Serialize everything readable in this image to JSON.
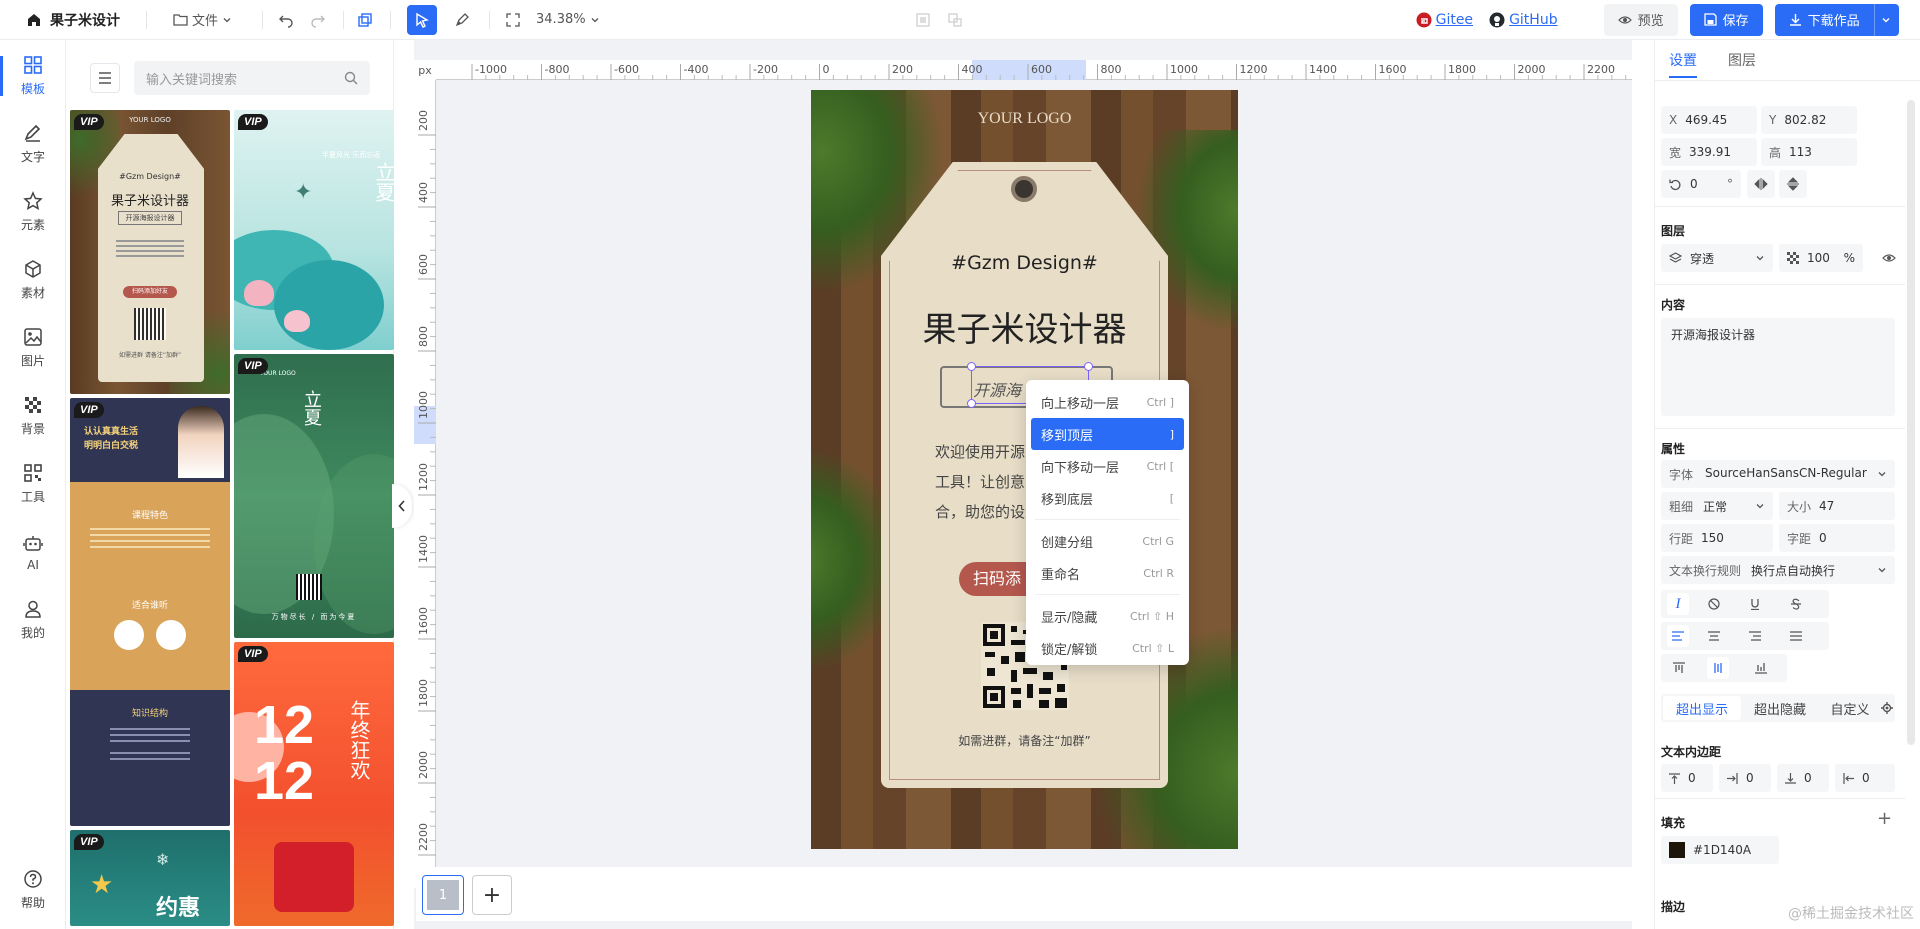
{
  "app": {
    "title": "果子米设计",
    "file_menu": "文件",
    "zoom": "34.38%"
  },
  "links": {
    "gitee": "Gitee",
    "github": "GitHub"
  },
  "actions": {
    "preview": "预览",
    "save": "保存",
    "download": "下载作品"
  },
  "nav": [
    {
      "label": "模板",
      "icon": "grid-icon"
    },
    {
      "label": "文字",
      "icon": "pen-icon"
    },
    {
      "label": "元素",
      "icon": "star-icon"
    },
    {
      "label": "素材",
      "icon": "cube-icon"
    },
    {
      "label": "图片",
      "icon": "image-icon"
    },
    {
      "label": "背景",
      "icon": "checker-icon"
    },
    {
      "label": "工具",
      "icon": "qrcode-icon"
    },
    {
      "label": "AI",
      "icon": "robot-icon"
    },
    {
      "label": "我的",
      "icon": "user-icon"
    },
    {
      "label": "帮助",
      "icon": "help-icon"
    }
  ],
  "search": {
    "placeholder": "输入关键词搜索"
  },
  "templates": {
    "t1": {
      "vip": "VIP",
      "logo": "YOUR LOGO",
      "tag": "#Gzm Design#",
      "title": "果子米设计器",
      "sub": "开源海报设计器",
      "btn": "扫码添加好友",
      "foot": "如需进群 请备注“加群”"
    },
    "t2": {
      "vip": "VIP",
      "title": "立夏",
      "sub": "半夏风光 乐而忘返"
    },
    "t3": {
      "vip": "VIP",
      "title": "认认真真生活",
      "title2": "明明白白交税",
      "sec1": "课程特色",
      "sec2": "适合谁听",
      "sec3": "知识结构"
    },
    "t4": {
      "vip": "VIP",
      "logo": "YOUR LOGO",
      "title": "立夏",
      "foot": "万物尽长 / 而为今夏"
    },
    "t5": {
      "vip": "VIP",
      "num": "12",
      "num2": "12",
      "text": "年终狂欢"
    },
    "t6": {
      "vip": "VIP",
      "text": "约惠"
    }
  },
  "ruler": {
    "unit": "px",
    "h_labels": [
      "-1000",
      "-800",
      "-600",
      "-400",
      "-200",
      "0",
      "200",
      "400",
      "600",
      "800",
      "1000",
      "1200",
      "1400",
      "1600",
      "1800",
      "2000",
      "2200"
    ],
    "v_labels": [
      "200",
      "400",
      "600",
      "800",
      "1000",
      "1200",
      "1400",
      "1600",
      "1800",
      "2000",
      "2200"
    ]
  },
  "poster": {
    "logo": "YOUR LOGO",
    "tag": "#Gzm Design#",
    "title": "果子米设计器",
    "selected_text": "开源海",
    "body1": "欢迎使用开源",
    "body2": "工具！让创意",
    "body3": "合，助您的设",
    "scan_btn": "扫码添",
    "footer": "如需进群，请备注“加群”"
  },
  "context_menu": [
    {
      "label": "向上移动一层",
      "shortcut": "Ctrl ]"
    },
    {
      "label": "移到顶层",
      "shortcut": "]",
      "active": true
    },
    {
      "label": "向下移动一层",
      "shortcut": "Ctrl ["
    },
    {
      "label": "移到底层",
      "shortcut": "["
    },
    {
      "label": "创建分组",
      "shortcut": "Ctrl G"
    },
    {
      "label": "重命名",
      "shortcut": "Ctrl R"
    },
    {
      "label": "显示/隐藏",
      "shortcut": "Ctrl ⇧ H"
    },
    {
      "label": "锁定/解锁",
      "shortcut": "Ctrl ⇧ L"
    }
  ],
  "pages": {
    "current": "1",
    "add": "+"
  },
  "panel": {
    "tabs": [
      "设置",
      "图层"
    ],
    "x_label": "X",
    "x": "469.45",
    "y_label": "Y",
    "y": "802.82",
    "w_label": "宽",
    "w": "339.91",
    "h_label": "高",
    "h": "113",
    "rotation": "0",
    "rotation_unit": "°",
    "layer_section": "图层",
    "blend": "穿透",
    "opacity": "100",
    "opacity_unit": "%",
    "content_section": "内容",
    "content": "开源海报设计器",
    "props_section": "属性",
    "font_label": "字体",
    "font": "SourceHanSansCN-Regular",
    "weight_label": "粗细",
    "weight": "正常",
    "size_label": "大小",
    "size": "47",
    "line_label": "行距",
    "line": "150",
    "letter_label": "字距",
    "letter": "0",
    "wrap_label": "文本换行规则",
    "wrap": "换行点自动换行",
    "overflow": [
      "超出显示",
      "超出隐藏",
      "自定义"
    ],
    "padding_section": "文本内边距",
    "padding": [
      "0",
      "0",
      "0",
      "0"
    ],
    "fill_section": "填充",
    "fill_color": "#1D140A",
    "stroke_section": "描边"
  },
  "colors": {
    "accent": "#2b6cf6",
    "fill": "#1D140A"
  },
  "watermark": "@稀土掘金技术社区"
}
